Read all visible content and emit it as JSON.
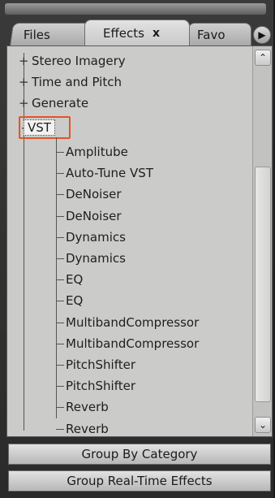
{
  "tabs": {
    "files": "Files",
    "effects": "Effects",
    "close_glyph": "x",
    "favorites": "Favo",
    "scroll_glyph": "▶"
  },
  "tree": {
    "groups": [
      "Stereo Imagery",
      "Time and Pitch",
      "Generate"
    ],
    "expanded_group": "VST",
    "expander_collapsed": "+",
    "expander_expanded": "-",
    "vst_items": [
      "Amplitube",
      "Auto-Tune VST",
      "DeNoiser",
      "DeNoiser",
      "Dynamics",
      "Dynamics",
      "EQ",
      "EQ",
      "MultibandCompressor",
      "MultibandCompressor",
      "PitchShifter",
      "PitchShifter",
      "Reverb",
      "Reverb"
    ]
  },
  "scrollbar": {
    "up_glyph": "⌃",
    "down_glyph": "⌄"
  },
  "buttons": {
    "group_by_category": "Group By Category",
    "group_realtime": "Group Real-Time Effects"
  },
  "colors": {
    "highlight_box": "#e0552a"
  }
}
